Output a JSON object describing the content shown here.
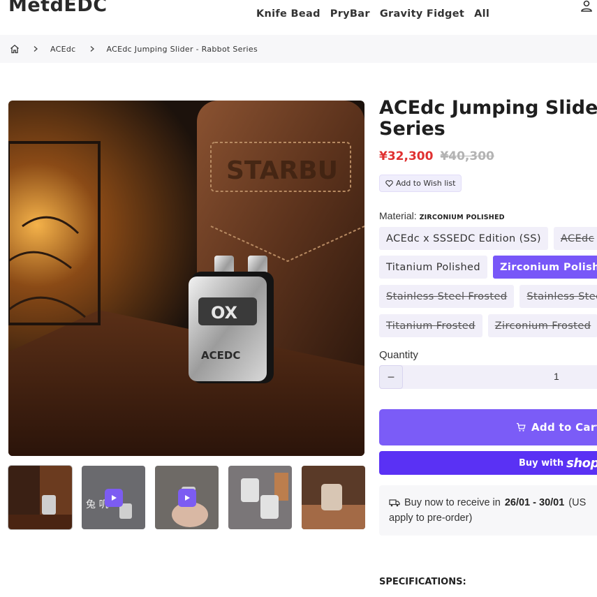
{
  "header": {
    "logo": "MetdEDC",
    "nav": [
      "Knife Bead",
      "PryBar",
      "Gravity Fidget",
      "All"
    ]
  },
  "breadcrumb": {
    "items": [
      "ACEdc",
      "ACEdc Jumping Slider - Rabbot Series"
    ]
  },
  "product": {
    "title_line1": "ACEdc Jumping Slider",
    "title_line2": "Series",
    "price_sale": "¥32,300",
    "price_compare": "¥40,300",
    "wishlist_label": "Add to Wish list",
    "material_label": "Material:",
    "material_value": "ZIRCONIUM POLISHED",
    "variants": [
      {
        "label": "ACEdc x SSSEDC Edition (SS)",
        "state": "available"
      },
      {
        "label": "ACEdc",
        "state": "soldout"
      },
      {
        "label": "Titanium Polished",
        "state": "available"
      },
      {
        "label": "Zirconium Polished",
        "state": "selected"
      },
      {
        "label": "Stainless Steel Frosted",
        "state": "soldout"
      },
      {
        "label": "Stainless Steel",
        "state": "soldout"
      },
      {
        "label": "Titanium Frosted",
        "state": "soldout"
      },
      {
        "label": "Zirconium Frosted",
        "state": "soldout"
      }
    ],
    "quantity_label": "Quantity",
    "quantity_value": "1",
    "quantity_minus": "−",
    "add_to_cart": "Add to Cart",
    "buy_with": "Buy with",
    "shop_brand": "shop",
    "delivery_prefix": "Buy now to receive in",
    "delivery_dates": "26/01 - 30/01",
    "delivery_suffix": "(US",
    "delivery_line2": "apply to pre-order)",
    "specs_heading": "SPECIFICATIONS:"
  },
  "gallery": {
    "thumbnails": [
      {
        "kind": "image",
        "active": true
      },
      {
        "kind": "video"
      },
      {
        "kind": "video"
      },
      {
        "kind": "image"
      },
      {
        "kind": "image"
      }
    ]
  },
  "colors": {
    "accent": "#7857f8",
    "shop_pay": "#5a31f4",
    "sale_price": "#e03131"
  },
  "icons": [
    "user-icon",
    "home-icon",
    "chevron-right-icon",
    "heart-icon",
    "cart-icon",
    "truck-icon",
    "play-icon"
  ]
}
